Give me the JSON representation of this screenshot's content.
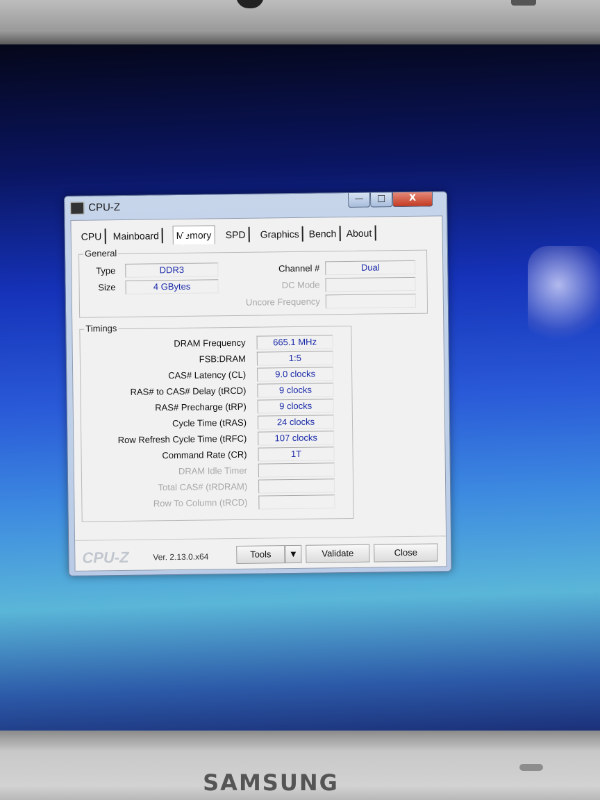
{
  "device": {
    "brand": "SAMSUNG"
  },
  "window": {
    "title": "CPU-Z",
    "buttons": {
      "minimize": "—",
      "maximize": "□",
      "close": "X"
    }
  },
  "tabs": [
    {
      "label": "CPU"
    },
    {
      "label": "Mainboard"
    },
    {
      "label": "Memory",
      "active": true
    },
    {
      "label": "SPD"
    },
    {
      "label": "Graphics"
    },
    {
      "label": "Bench"
    },
    {
      "label": "About"
    }
  ],
  "general": {
    "label": "General",
    "type_label": "Type",
    "type_value": "DDR3",
    "size_label": "Size",
    "size_value": "4 GBytes",
    "channel_label": "Channel #",
    "channel_value": "Dual",
    "dc_mode_label": "DC Mode",
    "dc_mode_value": "",
    "uncore_label": "Uncore Frequency",
    "uncore_value": ""
  },
  "timings": {
    "label": "Timings",
    "rows": [
      {
        "label": "DRAM Frequency",
        "value": "665.1 MHz",
        "enabled": true
      },
      {
        "label": "FSB:DRAM",
        "value": "1:5",
        "enabled": true
      },
      {
        "label": "CAS# Latency (CL)",
        "value": "9.0 clocks",
        "enabled": true
      },
      {
        "label": "RAS# to CAS# Delay (tRCD)",
        "value": "9 clocks",
        "enabled": true
      },
      {
        "label": "RAS# Precharge (tRP)",
        "value": "9 clocks",
        "enabled": true
      },
      {
        "label": "Cycle Time (tRAS)",
        "value": "24 clocks",
        "enabled": true
      },
      {
        "label": "Row Refresh Cycle Time (tRFC)",
        "value": "107 clocks",
        "enabled": true
      },
      {
        "label": "Command Rate (CR)",
        "value": "1T",
        "enabled": true
      },
      {
        "label": "DRAM Idle Timer",
        "value": "",
        "enabled": false
      },
      {
        "label": "Total CAS# (tRDRAM)",
        "value": "",
        "enabled": false
      },
      {
        "label": "Row To Column (tRCD)",
        "value": "",
        "enabled": false
      }
    ]
  },
  "footer": {
    "logo": "CPU-Z",
    "version": "Ver. 2.13.0.x64",
    "tools_label": "Tools",
    "tools_arrow": "▼",
    "validate_label": "Validate",
    "close_label": "Close"
  }
}
